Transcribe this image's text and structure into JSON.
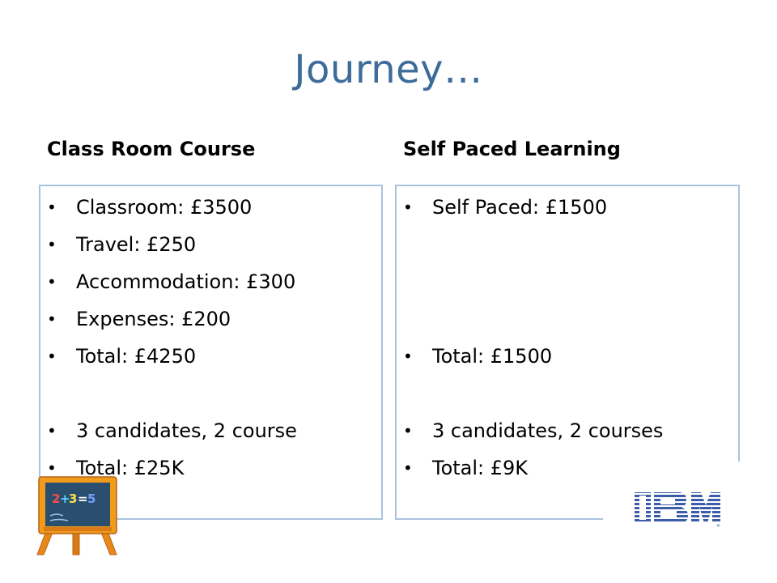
{
  "slide": {
    "title": "Journey…",
    "left": {
      "heading": "Class Room Course",
      "items": [
        "Classroom:  £3500",
        "Travel: £250",
        "Accommodation: £300",
        "Expenses: £200",
        "Total: £4250",
        "3 candidates, 2 course",
        "Total: £25K"
      ]
    },
    "right": {
      "heading": "Self Paced Learning",
      "items": [
        "Self Paced: £1500",
        "Total: £1500",
        "3 candidates, 2 courses",
        "Total: £9K"
      ]
    },
    "bullet": "•",
    "blackboard_text": "2+3=5",
    "logo_text": "IBM"
  },
  "colors": {
    "title": "#3d6b9a",
    "panel_border": "#a9c3df",
    "ibm_blue": "#3b5ca8",
    "board": "#f29a1e"
  }
}
